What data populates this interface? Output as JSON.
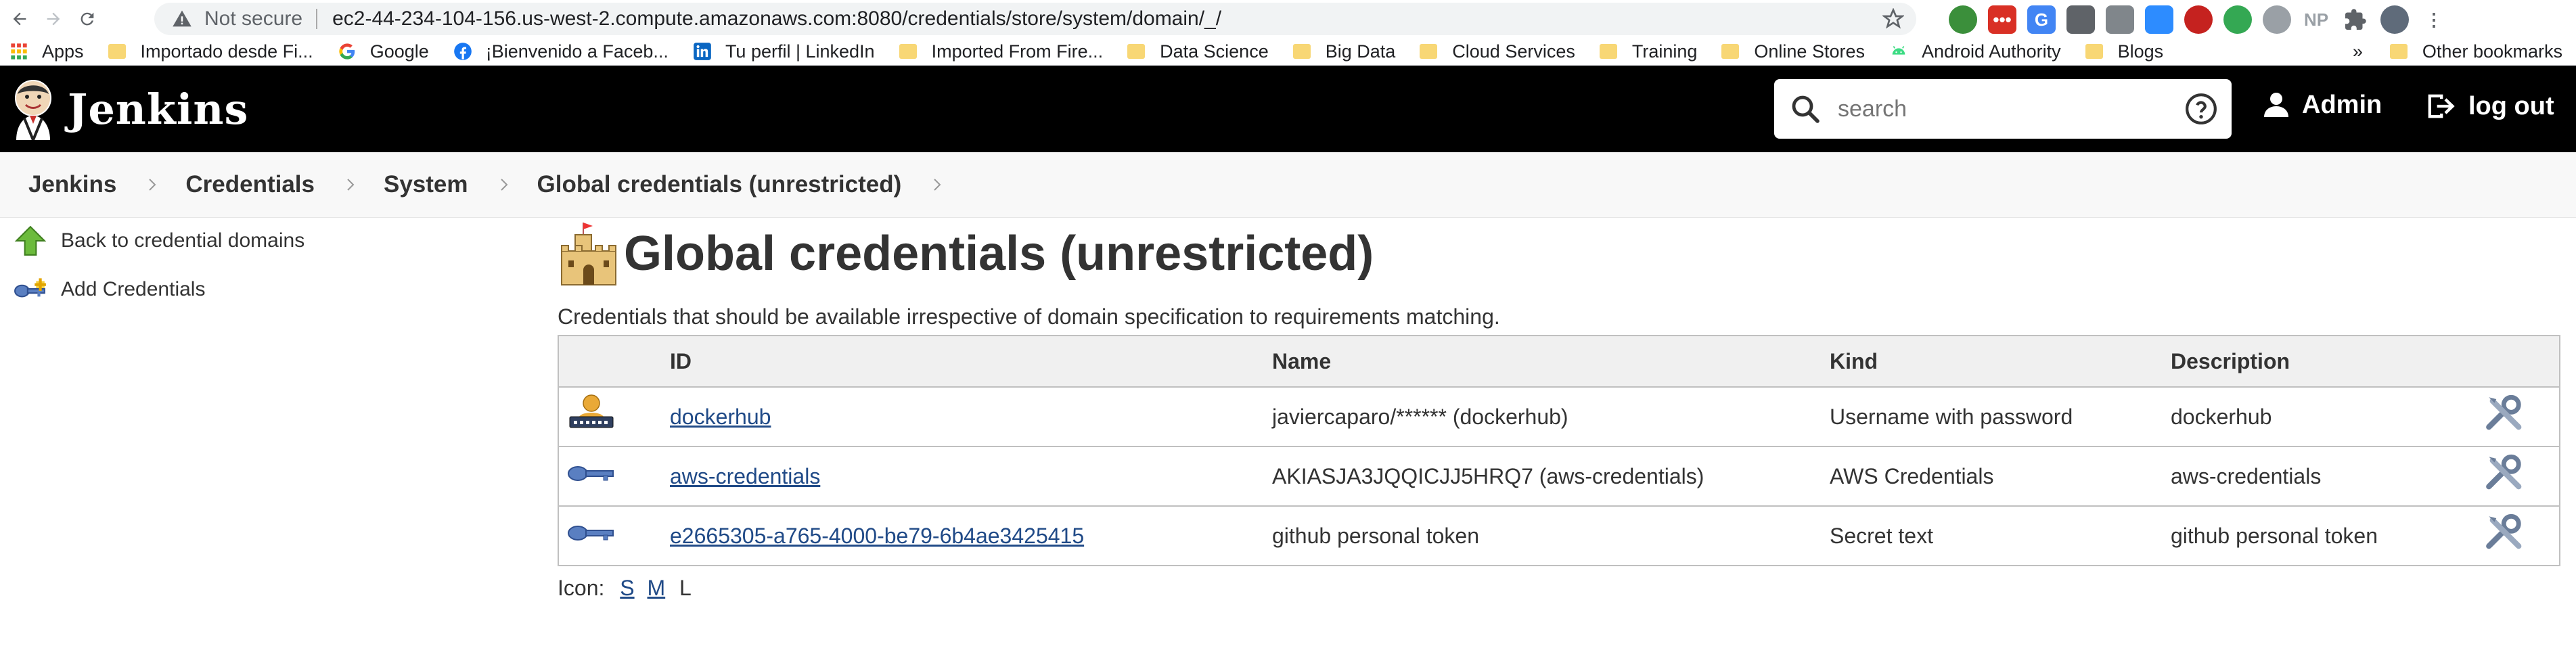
{
  "browser": {
    "security_label": "Not secure",
    "url": "ec2-44-234-104-156.us-west-2.compute.amazonaws.com:8080/credentials/store/system/domain/_/",
    "extensions": [
      "NP"
    ],
    "bookmarks": [
      {
        "label": "Apps",
        "icon": "apps-grid-icon"
      },
      {
        "label": "Importado desde Fi...",
        "icon": "folder-icon"
      },
      {
        "label": "Google",
        "icon": "google-icon"
      },
      {
        "label": "¡Bienvenido a Faceb...",
        "icon": "facebook-icon"
      },
      {
        "label": "Tu perfil | LinkedIn",
        "icon": "linkedin-icon"
      },
      {
        "label": "Imported From Fire...",
        "icon": "folder-icon"
      },
      {
        "label": "Data Science",
        "icon": "folder-icon"
      },
      {
        "label": "Big Data",
        "icon": "folder-icon"
      },
      {
        "label": "Cloud Services",
        "icon": "folder-icon"
      },
      {
        "label": "Training",
        "icon": "folder-icon"
      },
      {
        "label": "Online Stores",
        "icon": "folder-icon"
      },
      {
        "label": "Android Authority",
        "icon": "android-icon"
      },
      {
        "label": "Blogs",
        "icon": "folder-icon"
      }
    ],
    "more_bookmarks": "»",
    "other_bookmarks": "Other bookmarks"
  },
  "header": {
    "title": "Jenkins",
    "search_placeholder": "search",
    "user": "Admin",
    "logout": "log out"
  },
  "breadcrumbs": [
    "Jenkins",
    "Credentials",
    "System",
    "Global credentials (unrestricted)"
  ],
  "sidebar": {
    "items": [
      {
        "label": "Back to credential domains",
        "icon": "up-arrow-icon"
      },
      {
        "label": "Add Credentials",
        "icon": "key-icon"
      }
    ]
  },
  "main": {
    "title": "Global credentials (unrestricted)",
    "description": "Credentials that should be available irrespective of domain specification to requirements matching.",
    "columns": [
      "",
      "ID",
      "Name",
      "Kind",
      "Description",
      ""
    ],
    "rows": [
      {
        "icon": "user-password-icon",
        "id": "dockerhub",
        "name": "javiercaparo/****** (dockerhub)",
        "kind": "Username with password",
        "description": "dockerhub"
      },
      {
        "icon": "key-icon",
        "id": "aws-credentials",
        "name": "AKIASJA3JQQICJJ5HRQ7 (aws-credentials)",
        "kind": "AWS Credentials",
        "description": "aws-credentials"
      },
      {
        "icon": "key-icon",
        "id": "e2665305-a765-4000-be79-6b4ae3425415",
        "name": "github personal token",
        "kind": "Secret text",
        "description": "github personal token"
      }
    ],
    "icon_size": {
      "label": "Icon:",
      "small": "S",
      "medium": "M",
      "large": "L"
    }
  },
  "colors": {
    "header_bg": "#000000",
    "link": "#204a87",
    "breadcrumb_bg": "#f8f8f8"
  }
}
